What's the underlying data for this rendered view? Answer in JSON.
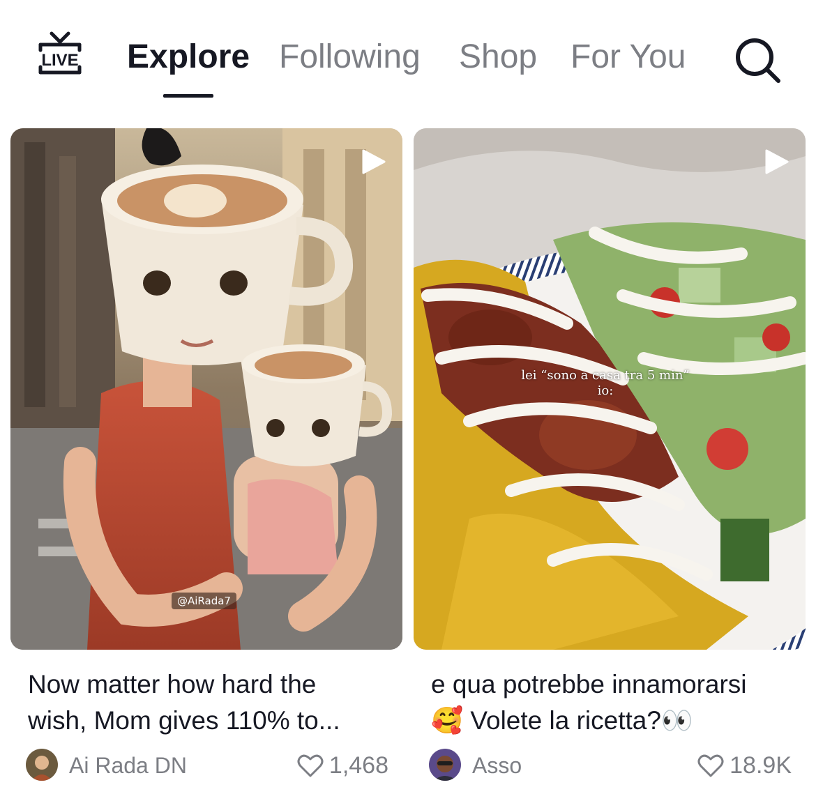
{
  "nav": {
    "live_label": "LIVE",
    "tabs": [
      {
        "label": "Explore",
        "active": true
      },
      {
        "label": "Following",
        "active": false
      },
      {
        "label": "Shop",
        "active": false
      },
      {
        "label": "For You",
        "active": false
      }
    ],
    "search_icon": "search-icon"
  },
  "cards": [
    {
      "caption_line1": "Now matter how hard the",
      "caption_line2": "wish, Mom gives 110% to...",
      "author": "Ai Rada DN",
      "likes": "1,468",
      "watermark": "@AiRada7",
      "thumb_description_icon": "play-icon"
    },
    {
      "caption_line1": "e qua potrebbe innamorarsi",
      "caption_line2_emoji": "🥰",
      "caption_line2": "Volete la ricetta?",
      "caption_line2_tail": "👀",
      "author": "Asso",
      "likes": "18.9K",
      "overlay_line1": "lei “sono a casa tra 5 min”",
      "overlay_line2": "io:",
      "thumb_description_icon": "play-icon"
    }
  ],
  "colors": {
    "primary_text": "#161823",
    "secondary_text": "#7c7e84",
    "background": "#ffffff"
  }
}
